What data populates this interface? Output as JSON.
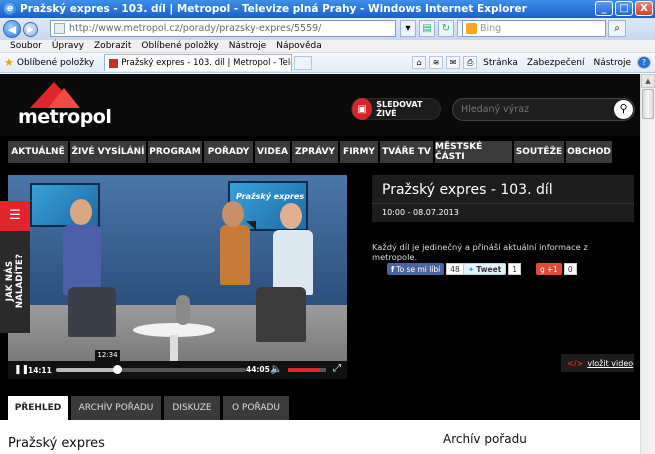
{
  "window": {
    "title": "Pražský expres - 103. díl | Metropol - Televize plná Prahy - Windows Internet Explorer",
    "controls": [
      "_",
      "□",
      "X"
    ]
  },
  "browser": {
    "url": "http://www.metropol.cz/porady/prazsky-expres/5559/",
    "search_placeholder": "Bing",
    "menu": [
      "Soubor",
      "Úpravy",
      "Zobrazit",
      "Oblíbené položky",
      "Nástroje",
      "Nápověda"
    ],
    "favorites_label": "Oblíbené položky",
    "tab_title": "Pražský expres - 103. díl | Metropol - Televize plná Pr...",
    "cmd": {
      "page": "Stránka",
      "security": "Zabezpečení",
      "tools": "Nástroje"
    }
  },
  "site": {
    "logo": "metropol",
    "live_label": "SLEDOVAT ŽIVĚ",
    "search_placeholder": "Hledaný výraz",
    "nav": [
      "AKTUÁLNĚ",
      "ŽIVÉ VYSÍLÁNÍ",
      "PROGRAM",
      "POŘADY",
      "VIDEA",
      "ZPRÁVY",
      "FIRMY",
      "TVÁŘE TV",
      "MĚSTSKÉ ČÁSTI",
      "SOUTĚŽE",
      "OBCHOD"
    ],
    "nav_active_index": 3,
    "side_tab": "JAK NÁS NALADÍTE?",
    "studio_screen_text": "Pražský expres"
  },
  "video": {
    "current_time": "14:11",
    "hover_time": "12:34",
    "duration": "44:05",
    "progress": 0.322,
    "volume": 0.85
  },
  "episode": {
    "title": "Pražský expres - 103. díl",
    "time_date": "10:00 - 08.07.2013",
    "description": "Každý díl je jedinečný a přináší aktuální informace z metropole.",
    "facebook_label": "To se mi líbí",
    "facebook_count": "48",
    "tweet_label": "Tweet",
    "tweet_count": "1",
    "gplus_label": "+1",
    "gplus_count": "0",
    "embed_code": "</>",
    "embed_label": "vložit video"
  },
  "lower_tabs": [
    "PŘEHLED",
    "ARCHÍV POŘADU",
    "DISKUZE",
    "O POŘADU"
  ],
  "lower_tabs_active_index": 0,
  "section_left": "Pražský expres",
  "section_right": "Archív pořadu",
  "colors": {
    "brand_red": "#e0262b",
    "page_bg": "#000000",
    "nav_bg": "#3a3a3a"
  }
}
